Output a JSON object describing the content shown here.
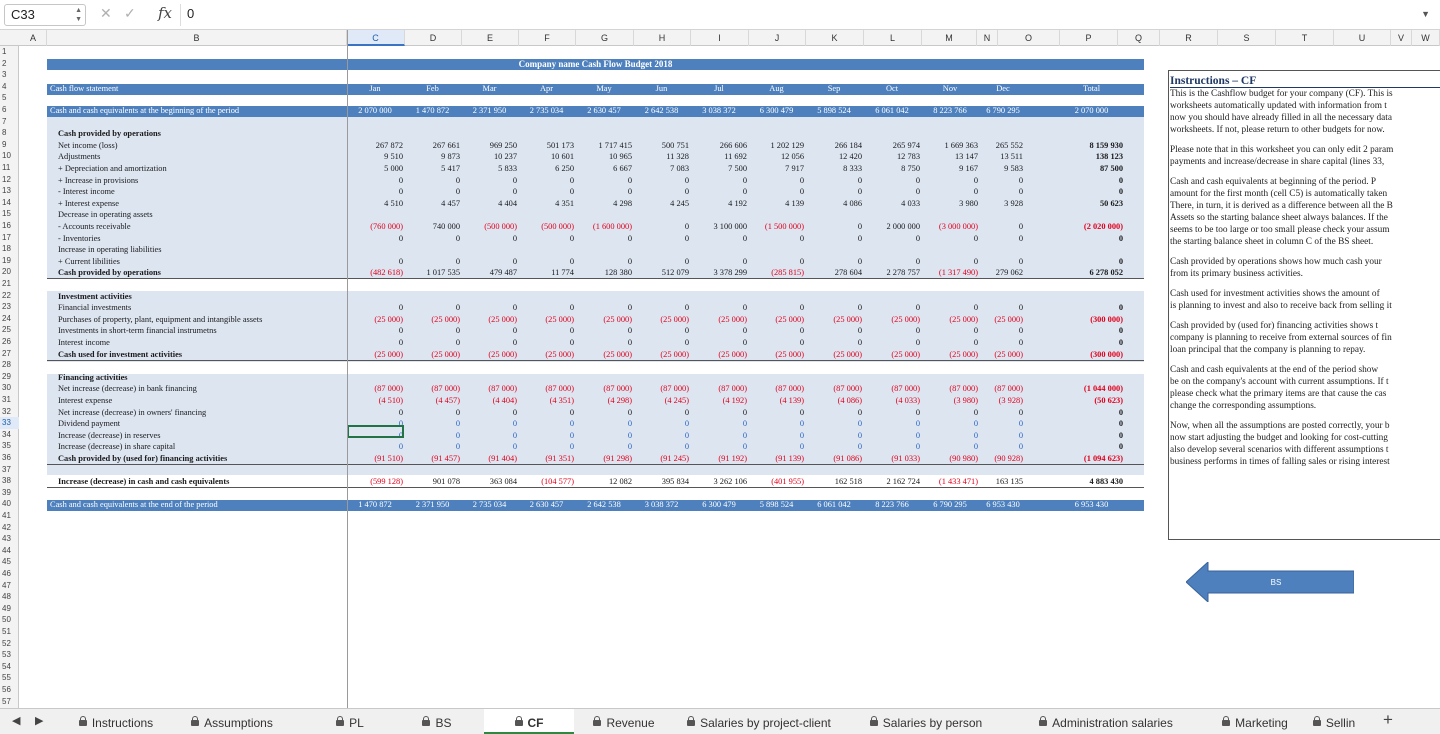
{
  "formula_bar": {
    "cell_ref": "C33",
    "value": "0"
  },
  "columns": [
    "A",
    "B",
    "C",
    "D",
    "E",
    "F",
    "G",
    "H",
    "I",
    "J",
    "K",
    "L",
    "M",
    "N",
    "O",
    "P",
    "Q",
    "R",
    "S",
    "T",
    "U",
    "V",
    "W"
  ],
  "active_column": "C",
  "active_row": "33",
  "rows": [
    "1",
    "2",
    "3",
    "4",
    "5",
    "6",
    "7",
    "8",
    "9",
    "10",
    "11",
    "12",
    "13",
    "14",
    "15",
    "16",
    "17",
    "18",
    "19",
    "20",
    "21",
    "22",
    "23",
    "24",
    "25",
    "26",
    "27",
    "28",
    "29",
    "30",
    "31",
    "32",
    "33",
    "34",
    "35",
    "36",
    "37",
    "38",
    "39",
    "40",
    "41",
    "42",
    "43",
    "44",
    "45",
    "46",
    "47",
    "48",
    "49",
    "50",
    "51",
    "52",
    "53",
    "54",
    "55",
    "56",
    "57"
  ],
  "sheet": {
    "title": "Company name Cash Flow Budget 2018",
    "months": [
      "Jan",
      "Feb",
      "Mar",
      "Apr",
      "May",
      "Jun",
      "Jul",
      "Aug",
      "Sep",
      "Oct",
      "Nov",
      "Dec",
      "Total"
    ],
    "header_label": "Cash flow statement",
    "lines": [
      {
        "r": 6,
        "label": "Cash and cash equivalents at the beginning of the period",
        "style": "bar",
        "v": [
          "2 070 000",
          "1 470 872",
          "2 371 950",
          "2 735 034",
          "2 630 457",
          "2 642 538",
          "3 038 372",
          "6 300 479",
          "5 898 524",
          "6 061 042",
          "8 223 766",
          "6 790 295",
          "2 070 000"
        ]
      },
      {
        "r": 8,
        "label": "Cash provided by operations",
        "style": "bold",
        "v": []
      },
      {
        "r": 9,
        "label": "Net income (loss)",
        "v": [
          "267 872",
          "267 661",
          "969 250",
          "501 173",
          "1 717 415",
          "500 751",
          "266 606",
          "1 202 129",
          "266 184",
          "265 974",
          "1 669 363",
          "265 552",
          "8 159 930"
        ]
      },
      {
        "r": 10,
        "label": "Adjustments",
        "v": [
          "9 510",
          "9 873",
          "10 237",
          "10 601",
          "10 965",
          "11 328",
          "11 692",
          "12 056",
          "12 420",
          "12 783",
          "13 147",
          "13 511",
          "138 123"
        ]
      },
      {
        "r": 11,
        "label": "+ Depreciation and amortization",
        "v": [
          "5 000",
          "5 417",
          "5 833",
          "6 250",
          "6 667",
          "7 083",
          "7 500",
          "7 917",
          "8 333",
          "8 750",
          "9 167",
          "9 583",
          "87 500"
        ]
      },
      {
        "r": 12,
        "label": "+ Increase in provisions",
        "v": [
          "0",
          "0",
          "0",
          "0",
          "0",
          "0",
          "0",
          "0",
          "0",
          "0",
          "0",
          "0",
          "0"
        ]
      },
      {
        "r": 13,
        "label": "- Interest income",
        "v": [
          "0",
          "0",
          "0",
          "0",
          "0",
          "0",
          "0",
          "0",
          "0",
          "0",
          "0",
          "0",
          "0"
        ]
      },
      {
        "r": 14,
        "label": "+ Interest expense",
        "v": [
          "4 510",
          "4 457",
          "4 404",
          "4 351",
          "4 298",
          "4 245",
          "4 192",
          "4 139",
          "4 086",
          "4 033",
          "3 980",
          "3 928",
          "50 623"
        ]
      },
      {
        "r": 15,
        "label": "Decrease in operating assets",
        "v": []
      },
      {
        "r": 16,
        "label": "- Accounts receivable",
        "v": [
          "(760 000)",
          "740 000",
          "(500 000)",
          "(500 000)",
          "(1 600 000)",
          "0",
          "3 100 000",
          "(1 500 000)",
          "0",
          "2 000 000",
          "(3 000 000)",
          "0",
          "(2 020 000)"
        ]
      },
      {
        "r": 17,
        "label": "- Inventories",
        "v": [
          "0",
          "0",
          "0",
          "0",
          "0",
          "0",
          "0",
          "0",
          "0",
          "0",
          "0",
          "0",
          "0"
        ]
      },
      {
        "r": 18,
        "label": "Increase in operating liabilities",
        "v": []
      },
      {
        "r": 19,
        "label": "+ Current libilities",
        "v": [
          "0",
          "0",
          "0",
          "0",
          "0",
          "0",
          "0",
          "0",
          "0",
          "0",
          "0",
          "0",
          "0"
        ]
      },
      {
        "r": 20,
        "label": "Cash provided by operations",
        "style": "total",
        "v": [
          "(482 618)",
          "1 017 535",
          "479 487",
          "11 774",
          "128 380",
          "512 079",
          "3 378 299",
          "(285 815)",
          "278 604",
          "2 278 757",
          "(1 317 490)",
          "279 062",
          "6 278 052"
        ]
      },
      {
        "r": 22,
        "label": "Investment activities",
        "style": "bold",
        "v": []
      },
      {
        "r": 23,
        "label": "Financial investments",
        "v": [
          "0",
          "0",
          "0",
          "0",
          "0",
          "0",
          "0",
          "0",
          "0",
          "0",
          "0",
          "0",
          "0"
        ]
      },
      {
        "r": 24,
        "label": "Purchases of property, plant, equipment and intangible assets",
        "v": [
          "(25 000)",
          "(25 000)",
          "(25 000)",
          "(25 000)",
          "(25 000)",
          "(25 000)",
          "(25 000)",
          "(25 000)",
          "(25 000)",
          "(25 000)",
          "(25 000)",
          "(25 000)",
          "(300 000)"
        ]
      },
      {
        "r": 25,
        "label": "Investments in short-term financial instrumetns",
        "v": [
          "0",
          "0",
          "0",
          "0",
          "0",
          "0",
          "0",
          "0",
          "0",
          "0",
          "0",
          "0",
          "0"
        ]
      },
      {
        "r": 26,
        "label": "Interest income",
        "v": [
          "0",
          "0",
          "0",
          "0",
          "0",
          "0",
          "0",
          "0",
          "0",
          "0",
          "0",
          "0",
          "0"
        ]
      },
      {
        "r": 27,
        "label": "Cash used for investment activities",
        "style": "total",
        "v": [
          "(25 000)",
          "(25 000)",
          "(25 000)",
          "(25 000)",
          "(25 000)",
          "(25 000)",
          "(25 000)",
          "(25 000)",
          "(25 000)",
          "(25 000)",
          "(25 000)",
          "(25 000)",
          "(300 000)"
        ]
      },
      {
        "r": 29,
        "label": "Financing activities",
        "style": "bold",
        "v": []
      },
      {
        "r": 30,
        "label": "Net increase (decrease) in bank financing",
        "v": [
          "(87 000)",
          "(87 000)",
          "(87 000)",
          "(87 000)",
          "(87 000)",
          "(87 000)",
          "(87 000)",
          "(87 000)",
          "(87 000)",
          "(87 000)",
          "(87 000)",
          "(87 000)",
          "(1 044 000)"
        ]
      },
      {
        "r": 31,
        "label": "Interest expense",
        "v": [
          "(4 510)",
          "(4 457)",
          "(4 404)",
          "(4 351)",
          "(4 298)",
          "(4 245)",
          "(4 192)",
          "(4 139)",
          "(4 086)",
          "(4 033)",
          "(3 980)",
          "(3 928)",
          "(50 623)"
        ]
      },
      {
        "r": 32,
        "label": "Net increase (decrease) in owners' financing",
        "v": [
          "0",
          "0",
          "0",
          "0",
          "0",
          "0",
          "0",
          "0",
          "0",
          "0",
          "0",
          "0",
          "0"
        ]
      },
      {
        "r": 33,
        "label": "Dividend payment",
        "blue": true,
        "v": [
          "0",
          "0",
          "0",
          "0",
          "0",
          "0",
          "0",
          "0",
          "0",
          "0",
          "0",
          "0",
          "0"
        ]
      },
      {
        "r": 34,
        "label": "Increase (decrease) in reserves",
        "blue": true,
        "v": [
          "0",
          "0",
          "0",
          "0",
          "0",
          "0",
          "0",
          "0",
          "0",
          "0",
          "0",
          "0",
          "0"
        ]
      },
      {
        "r": 35,
        "label": "Increase (decrease) in share capital",
        "blue": true,
        "v": [
          "0",
          "0",
          "0",
          "0",
          "0",
          "0",
          "0",
          "0",
          "0",
          "0",
          "0",
          "0",
          "0"
        ]
      },
      {
        "r": 36,
        "label": "Cash provided by (used for) financing activities",
        "style": "total",
        "v": [
          "(91 510)",
          "(91 457)",
          "(91 404)",
          "(91 351)",
          "(91 298)",
          "(91 245)",
          "(91 192)",
          "(91 139)",
          "(91 086)",
          "(91 033)",
          "(90 980)",
          "(90 928)",
          "(1 094 623)"
        ]
      },
      {
        "r": 38,
        "label": "Increase (decrease) in cash and cash equivalents",
        "style": "total",
        "v": [
          "(599 128)",
          "901 078",
          "363 084",
          "(104 577)",
          "12 082",
          "395 834",
          "3 262 106",
          "(401 955)",
          "162 518",
          "2 162 724",
          "(1 433 471)",
          "163 135",
          "4 883 430"
        ]
      },
      {
        "r": 40,
        "label": "Cash and cash equivalents at the end of the period",
        "style": "bar",
        "v": [
          "1 470 872",
          "2 371 950",
          "2 735 034",
          "2 630 457",
          "2 642 538",
          "3 038 372",
          "6 300 479",
          "5 898 524",
          "6 061 042",
          "8 223 766",
          "6 790 295",
          "6 953 430",
          "6 953 430"
        ]
      }
    ]
  },
  "instructions": {
    "title": "Instructions – CF",
    "paras": [
      [
        "This is the Cashflow budget for your company (CF). This is",
        "worksheets automatically updated with information from t",
        "now you should have already filled in all the necessary data",
        "worksheets. If not, please return to other budgets for now."
      ],
      [
        "Please note that in this worksheet you can only edit 2 param",
        "payments and increase/decrease in share capital (lines 33,"
      ],
      [
        "Cash and cash equivalents at beginning of the period. P",
        "amount for the first month (cell C5) is automatically taken",
        "There, in turn, it is derived as a difference between all the B",
        "Assets so the starting balance sheet always balances. If the",
        "seems to be too large or too small please check your assum",
        "the starting balance sheet in column C of the BS sheet."
      ],
      [
        "Cash provided by operations shows how much cash your",
        "from its primary business activities."
      ],
      [
        "Cash used for investment activities shows the amount of",
        "is planning to invest and also to receive back from selling it"
      ],
      [
        "Cash provided by (used for) financing activities shows t",
        "company is planning to receive from external sources of fin",
        "loan principal that the company is planning to repay."
      ],
      [
        "Cash and cash equivalents at the end of the period show",
        "be on the company's account with current assumptions. If t",
        "please check what the primary items are that cause the cas",
        "change the corresponding assumptions."
      ],
      [
        "Now, when all the assumptions are posted correctly, your b",
        "now start adjusting the budget and looking for cost-cutting",
        "also develop several scenarios with different assumptions t",
        "business performs in times of falling sales or rising interest"
      ]
    ]
  },
  "arrow_label": "BS",
  "tabs": [
    "Instructions",
    "Assumptions",
    "PL",
    "BS",
    "CF",
    "Revenue",
    "Salaries by project-client",
    "Salaries by person",
    "Administration salaries",
    "Marketing",
    "Sellin"
  ],
  "active_tab": "CF",
  "colors": {
    "header_blue": "#4d80bd",
    "band": "#dde5f1",
    "negative": "#e2001a",
    "input_blue": "#2a63c4",
    "active_tab_underline": "#2a8a3e"
  }
}
